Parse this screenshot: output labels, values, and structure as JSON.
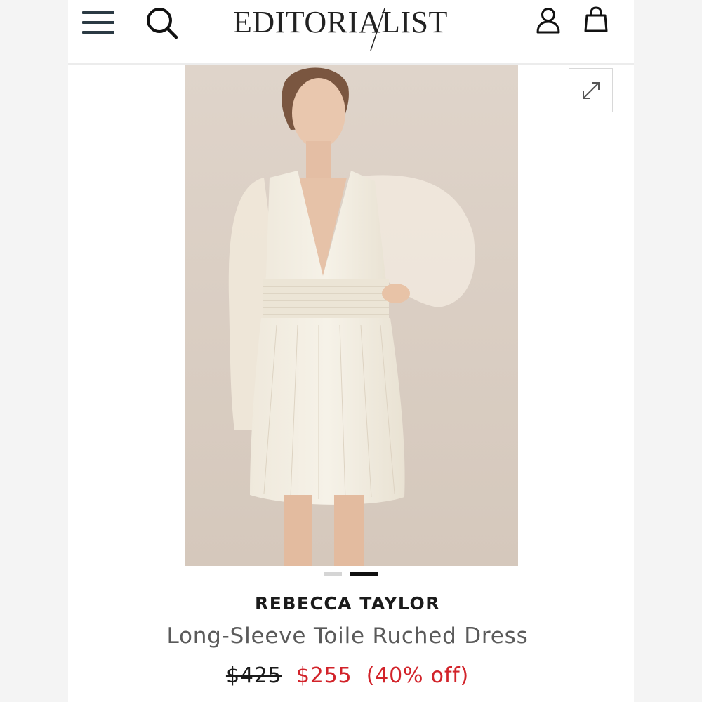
{
  "header": {
    "logo": "EDITORIALIST"
  },
  "icons": {
    "menu": "hamburger-menu-icon",
    "search": "search-icon",
    "account": "user-icon",
    "bag": "shopping-bag-icon",
    "expand": "expand-icon"
  },
  "product": {
    "image_alt": "Model wearing long-sleeve cream ruched mini dress",
    "brand": "REBECCA TAYLOR",
    "name": "Long-Sleeve Toile Ruched Dress",
    "price_original": "$425",
    "price_sale": "$255",
    "discount": "(40% off)"
  },
  "carousel": {
    "slide_count": 2,
    "active_index": 2
  },
  "colors": {
    "sale": "#d2232a",
    "text": "#1b1b1b",
    "icon": "#2b3a44",
    "image_bg": "#dcd0c6"
  }
}
